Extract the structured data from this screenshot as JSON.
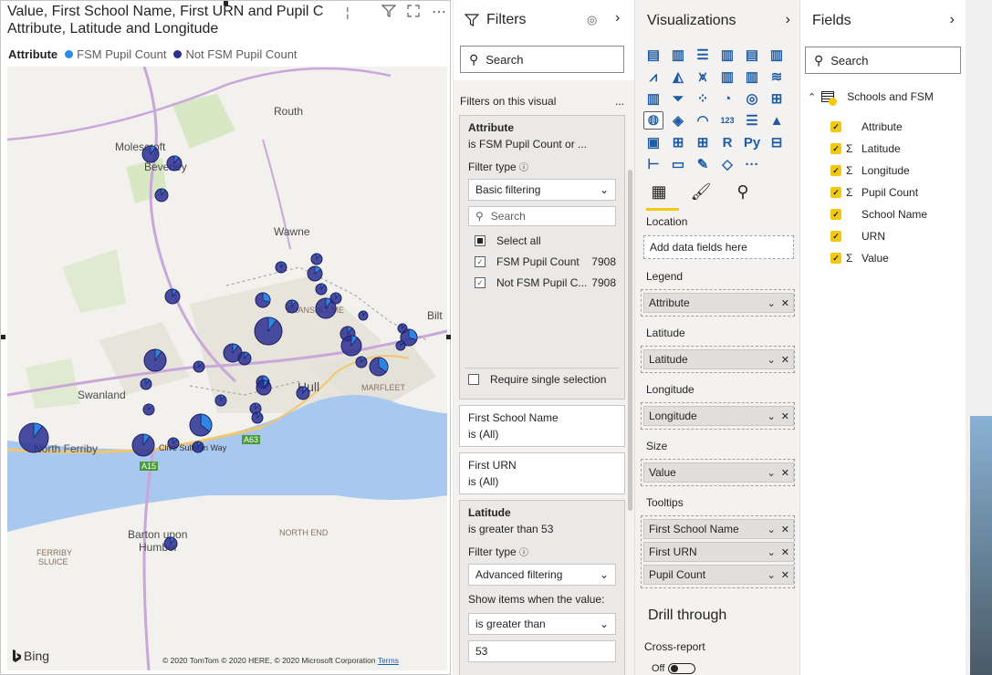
{
  "visual": {
    "title_line1": "Value, First School Name, First URN and Pupil C",
    "title_line2": "Attribute, Latitude and Longitude",
    "legend_title": "Attribute",
    "legend_items": [
      {
        "label": "FSM Pupil Count",
        "color": "#2b8cea"
      },
      {
        "label": "Not FSM Pupil Count",
        "color": "#2a2f92"
      }
    ],
    "map_labels": {
      "routh": "Routh",
      "molescroft": "Molescroft",
      "beverley": "Beverley",
      "wawne": "Wawne",
      "bransholme": "BRANSHOLME",
      "bilton": "Bilt",
      "swanland": "Swanland",
      "hull": "Hull",
      "marfleet": "MARFLEET",
      "north_ferriby": "North Ferriby",
      "clive_sullivan": "Clive Sullivan Way",
      "a63": "A63",
      "a15": "A15",
      "barton": "Barton upon",
      "humber": "Humber",
      "north_end": "NORTH END",
      "ferriby_sluice": "FERRIBY",
      "ferriby_sluice2": "SLUICE"
    },
    "bing": "Bing",
    "copyright": "© 2020 TomTom © 2020 HERE, © 2020 Microsoft Corporation",
    "terms": "Terms"
  },
  "filters": {
    "title": "Filters",
    "search_placeholder": "Search",
    "section": "Filters on this visual",
    "more": "...",
    "attribute_card": {
      "title": "Attribute",
      "subtitle": "is FSM Pupil Count or ...",
      "filter_type_label": "Filter type",
      "filter_type": "Basic filtering",
      "search_placeholder": "Search",
      "items": [
        {
          "label": "Select all",
          "count": ""
        },
        {
          "label": "FSM Pupil Count",
          "count": "7908"
        },
        {
          "label": "Not FSM Pupil C...",
          "count": "7908"
        }
      ],
      "require_single": "Require single selection"
    },
    "school_card": {
      "title": "First School Name",
      "subtitle": "is (All)"
    },
    "urn_card": {
      "title": "First URN",
      "subtitle": "is (All)"
    },
    "latitude_card": {
      "title": "Latitude",
      "subtitle": "is greater than 53",
      "filter_type_label": "Filter type",
      "filter_type": "Advanced filtering",
      "show_items_label": "Show items when the value:",
      "condition": "is greater than",
      "value": "53"
    }
  },
  "visualizations": {
    "title": "Visualizations",
    "location_label": "Location",
    "location_placeholder": "Add data fields here",
    "legend_label": "Legend",
    "legend_field": "Attribute",
    "latitude_label": "Latitude",
    "latitude_field": "Latitude",
    "longitude_label": "Longitude",
    "longitude_field": "Longitude",
    "size_label": "Size",
    "size_field": "Value",
    "tooltips_label": "Tooltips",
    "tooltips": [
      "First School Name",
      "First URN",
      "Pupil Count"
    ],
    "drill_through": "Drill through",
    "cross_report": "Cross-report",
    "toggle": "Off",
    "r_label": "R",
    "py_label": "Py",
    "more_label": "···"
  },
  "fields": {
    "title": "Fields",
    "search_placeholder": "Search",
    "table_name": "Schools and FSM",
    "items": [
      {
        "name": "Attribute",
        "sigma": ""
      },
      {
        "name": "Latitude",
        "sigma": "Σ"
      },
      {
        "name": "Longitude",
        "sigma": "Σ"
      },
      {
        "name": "Pupil Count",
        "sigma": "Σ"
      },
      {
        "name": "School Name",
        "sigma": ""
      },
      {
        "name": "URN",
        "sigma": ""
      },
      {
        "name": "Value",
        "sigma": "Σ"
      }
    ]
  }
}
